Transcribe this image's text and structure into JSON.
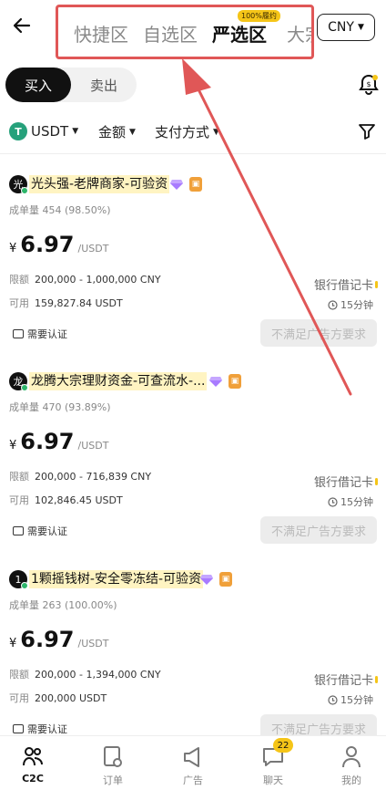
{
  "header": {
    "tabs": [
      {
        "label": "快捷区"
      },
      {
        "label": "自选区"
      },
      {
        "label": "严选区",
        "badge": "100%履约"
      },
      {
        "label": "大宗"
      }
    ],
    "currency": "CNY"
  },
  "toggle": {
    "buy": "买入",
    "sell": "卖出"
  },
  "filters": {
    "coin": "USDT",
    "amount": "金额",
    "payment": "支付方式"
  },
  "ads": [
    {
      "avatar": "光",
      "merchant": "光头强-老牌商家-可验资",
      "stats_label": "成单量",
      "stats": "454 (98.50%)",
      "currency_symbol": "¥",
      "price": "6.97",
      "unit": "/USDT",
      "limit_label": "限额",
      "limit": "200,000 - 1,000,000 CNY",
      "available_label": "可用",
      "available": "159,827.84 USDT",
      "payment_method": "银行借记卡",
      "time": "15分钟",
      "verify": "需要认证",
      "action": "不满足广告方要求"
    },
    {
      "avatar": "龙",
      "merchant": "龙腾大宗理财资金-可查流水-...",
      "stats_label": "成单量",
      "stats": "470 (93.89%)",
      "currency_symbol": "¥",
      "price": "6.97",
      "unit": "/USDT",
      "limit_label": "限额",
      "limit": "200,000 - 716,839 CNY",
      "available_label": "可用",
      "available": "102,846.45 USDT",
      "payment_method": "银行借记卡",
      "time": "15分钟",
      "verify": "需要认证",
      "action": "不满足广告方要求"
    },
    {
      "avatar": "1",
      "merchant": "1颗摇钱树-安全零冻结-可验资",
      "stats_label": "成单量",
      "stats": "263 (100.00%)",
      "currency_symbol": "¥",
      "price": "6.97",
      "unit": "/USDT",
      "limit_label": "限额",
      "limit": "200,000 - 1,394,000 CNY",
      "available_label": "可用",
      "available": "200,000 USDT",
      "payment_method": "银行借记卡",
      "time": "15分钟",
      "verify": "需要认证",
      "action": "不满足广告方要求"
    }
  ],
  "bottom_nav": [
    {
      "label": "C2C",
      "icon": "people-icon"
    },
    {
      "label": "订单",
      "icon": "order-icon"
    },
    {
      "label": "广告",
      "icon": "megaphone-icon"
    },
    {
      "label": "聊天",
      "icon": "chat-icon",
      "badge": "22"
    },
    {
      "label": "我的",
      "icon": "profile-icon"
    }
  ],
  "colors": {
    "highlight_box": "#e05757",
    "accent": "#f5c518",
    "online": "#2db56a",
    "tether": "#26a17b"
  }
}
